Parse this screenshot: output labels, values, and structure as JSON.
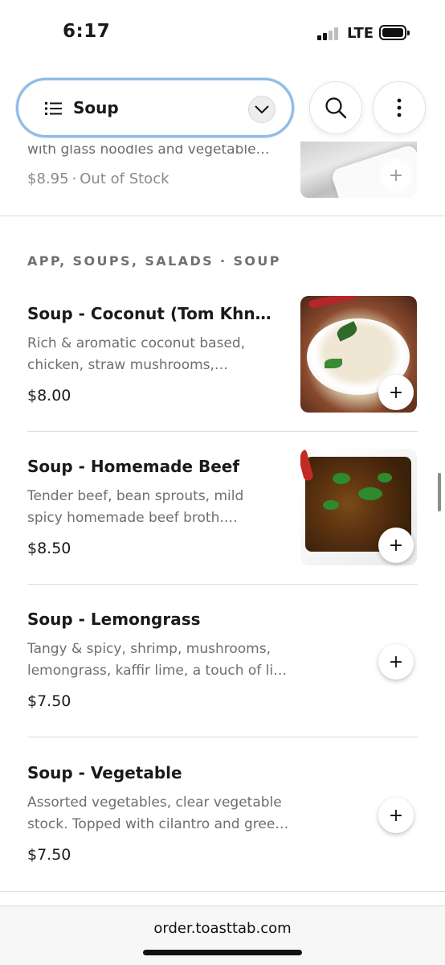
{
  "status_bar": {
    "time": "6:17",
    "network": "LTE",
    "signal_bars": 2,
    "battery_level": 0.9
  },
  "header": {
    "menu_selector_label": "Soup",
    "search_icon": "search-icon",
    "more_icon": "more-vertical-icon"
  },
  "partial_item": {
    "description": "with glass noodles and vegetable…",
    "price": "$8.95",
    "separator": "·",
    "stock_status": "Out of Stock"
  },
  "section": {
    "title": "APP, SOUPS, SALADS · SOUP"
  },
  "items": [
    {
      "name": "Soup - Coconut (Tom Khn…",
      "desc_line1": "Rich & aromatic coconut based,",
      "desc_line2": "chicken, straw mushrooms,…",
      "price": "$8.00",
      "has_image": true
    },
    {
      "name": "Soup - Homemade Beef",
      "desc_line1": "Tender beef, bean sprouts, mild",
      "desc_line2": "spicy homemade beef broth.…",
      "price": "$8.50",
      "has_image": true
    },
    {
      "name": "Soup - Lemongrass",
      "desc_line1": "Tangy & spicy, shrimp, mushrooms,",
      "desc_line2": "lemongrass, kaffir lime, a touch of li…",
      "price": "$7.50",
      "has_image": false
    },
    {
      "name": "Soup - Vegetable",
      "desc_line1": "Assorted vegetables, clear vegetable",
      "desc_line2": "stock. Topped with cilantro and gree…",
      "price": "$7.50",
      "has_image": false
    }
  ],
  "add_button_symbol": "+",
  "footer": {
    "url": "order.toasttab.com"
  },
  "colors": {
    "selector_border": "#8fbbe6",
    "text_primary": "#1a1a1a",
    "text_secondary": "#6e6e6e",
    "divider": "#dcdcdc"
  }
}
